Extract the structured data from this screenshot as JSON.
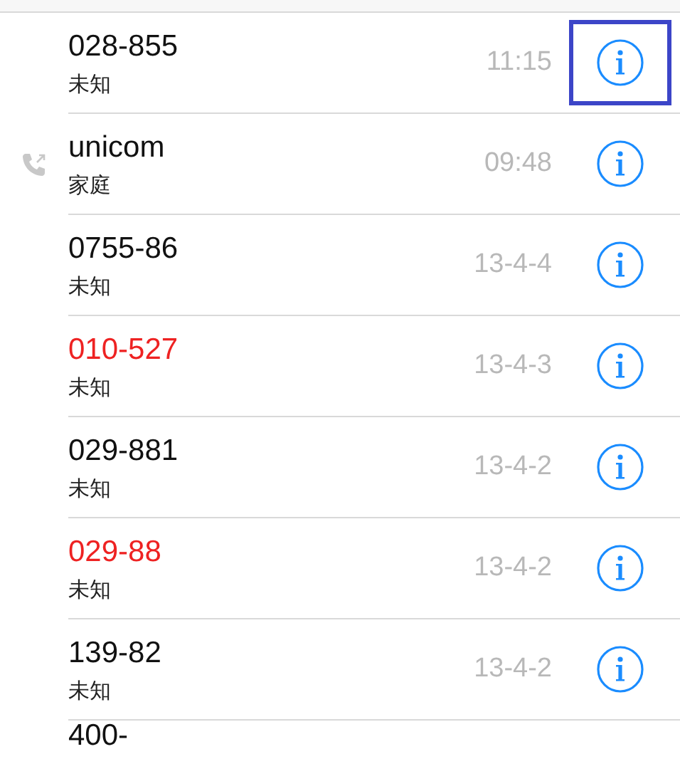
{
  "calls": [
    {
      "number": "028-855",
      "label": "未知",
      "time": "11:15",
      "missed": false,
      "outgoing": false,
      "highlighted": true
    },
    {
      "number": "unicom",
      "label": "家庭",
      "time": "09:48",
      "missed": false,
      "outgoing": true,
      "highlighted": false
    },
    {
      "number": "0755-86",
      "label": "未知",
      "time": "13-4-4",
      "missed": false,
      "outgoing": false,
      "highlighted": false
    },
    {
      "number": "010-527",
      "label": "未知",
      "time": "13-4-3",
      "missed": true,
      "outgoing": false,
      "highlighted": false
    },
    {
      "number": "029-881",
      "label": "未知",
      "time": "13-4-2",
      "missed": false,
      "outgoing": false,
      "highlighted": false
    },
    {
      "number": "029-88",
      "label": "未知",
      "time": "13-4-2",
      "missed": true,
      "outgoing": false,
      "highlighted": false
    },
    {
      "number": "139-82",
      "label": "未知",
      "time": "13-4-2",
      "missed": false,
      "outgoing": false,
      "highlighted": false
    }
  ],
  "partial_row": {
    "number": "400-"
  }
}
